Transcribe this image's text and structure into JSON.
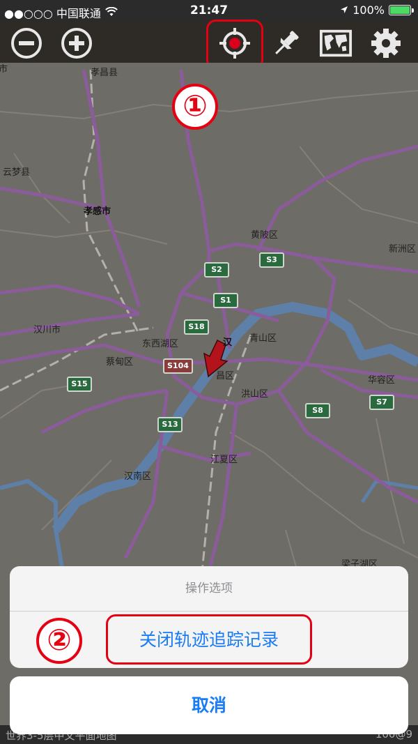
{
  "status_bar": {
    "carrier": "●●○○○ 中国联通",
    "time": "21:47",
    "battery": "100%"
  },
  "toolbar": {
    "buttons": [
      "zoom-out",
      "zoom-in",
      "locate",
      "pin",
      "map-layers",
      "settings"
    ]
  },
  "annotations": {
    "step1": "①",
    "step2": "②"
  },
  "map": {
    "labels": [
      {
        "text": "孝昌县"
      },
      {
        "text": "云梦县"
      },
      {
        "text": "孝感市",
        "bold": true
      },
      {
        "text": "黄陂区"
      },
      {
        "text": "新洲区"
      },
      {
        "text": "汉川市"
      },
      {
        "text": "东西湖区"
      },
      {
        "text": "青山区"
      },
      {
        "text": "蔡甸区"
      },
      {
        "text": "洪山区"
      },
      {
        "text": "华容区"
      },
      {
        "text": "江夏区"
      },
      {
        "text": "汉南区"
      },
      {
        "text": "梁子湖区"
      },
      {
        "text": "市"
      },
      {
        "text": "汉"
      },
      {
        "text": "昌区"
      }
    ],
    "shields": [
      "S3",
      "S2",
      "S1",
      "S18",
      "S104",
      "S15",
      "S13",
      "S8",
      "S7"
    ]
  },
  "action_sheet": {
    "title": "操作选项",
    "action": "关闭轨迹追踪记录",
    "cancel": "取消"
  },
  "bottom_strip": {
    "left": "世界3-5层中文平面地图",
    "right": "100@9"
  },
  "colors": {
    "highlight": "#e50012",
    "ios_blue": "#1a7cf2"
  }
}
